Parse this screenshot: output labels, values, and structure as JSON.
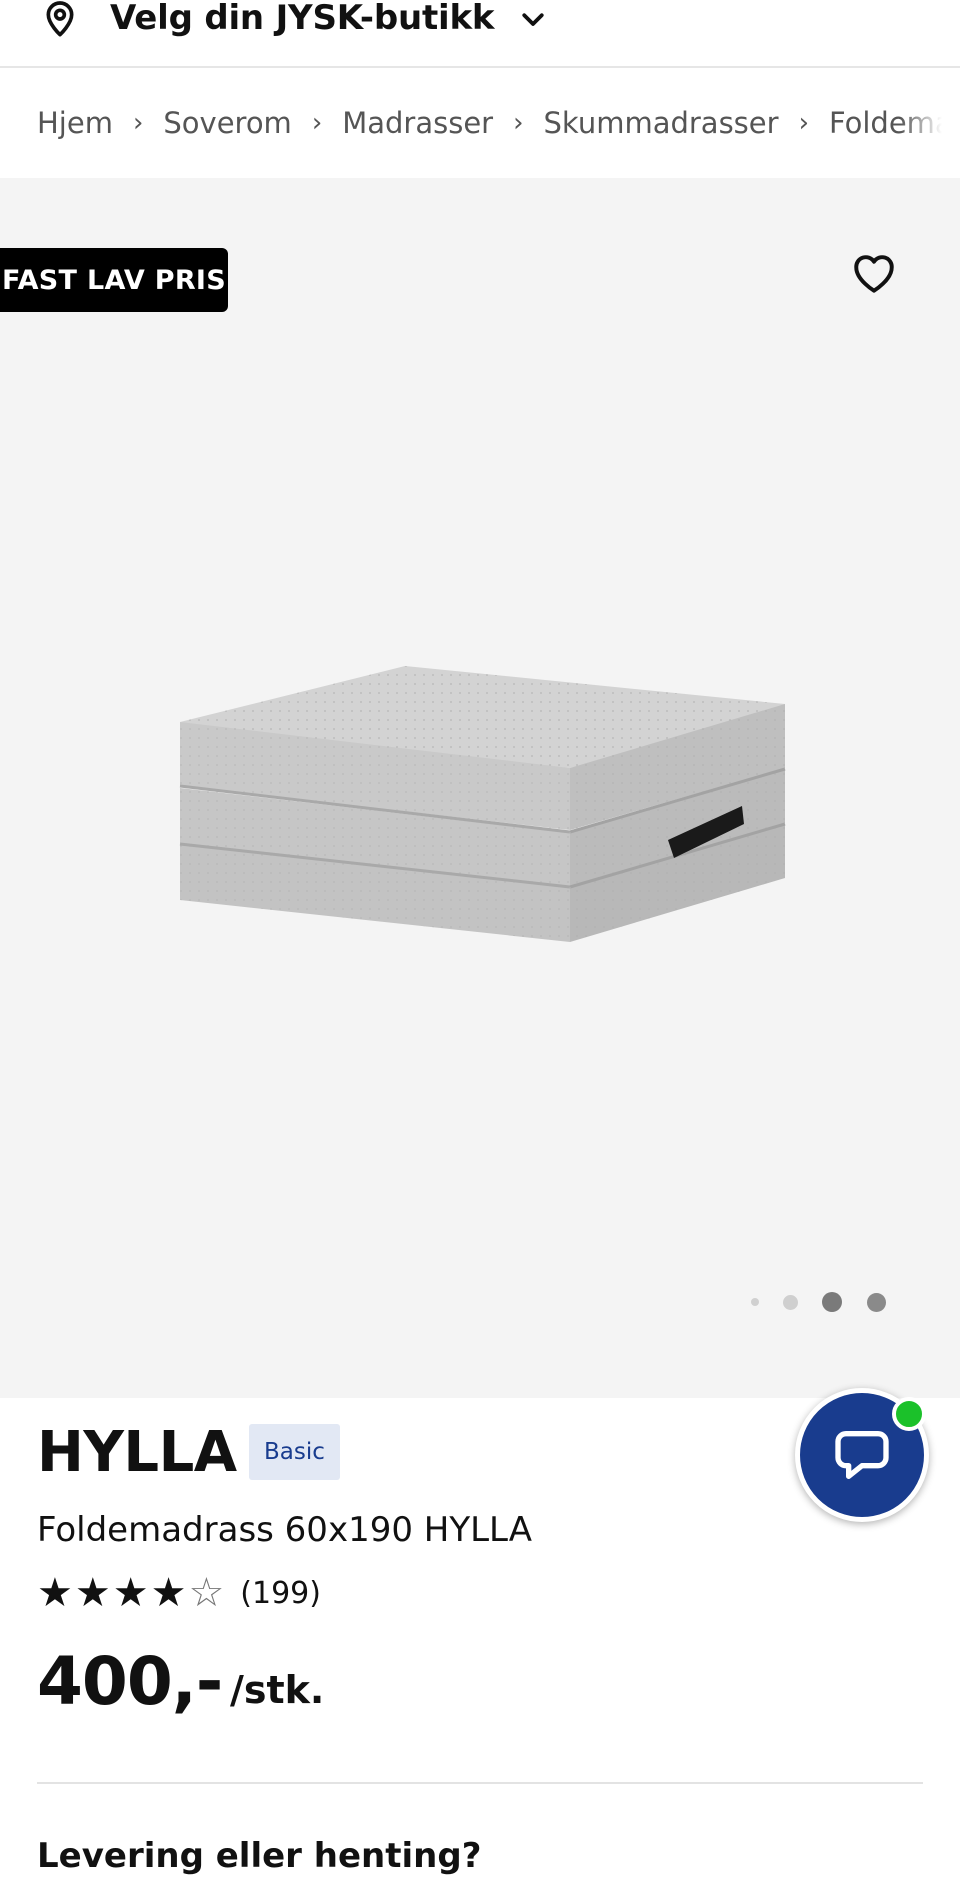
{
  "store_bar": {
    "label": "Velg din JYSK-butikk",
    "pin_icon": "location-pin-icon",
    "chevron_icon": "chevron-down-icon"
  },
  "breadcrumb": {
    "items": [
      "Hjem",
      "Soverom",
      "Madrasser",
      "Skummadrasser",
      "Foldema"
    ]
  },
  "gallery": {
    "badge": "FAST LAV PRIS",
    "favorite_icon": "heart-icon",
    "image_count": 4,
    "active_index": 2
  },
  "product": {
    "brand": "HYLLA",
    "tag": "Basic",
    "name": "Foldemadrass 60x190 HYLLA",
    "rating": 4,
    "rating_max": 5,
    "review_count": "(199)",
    "price": "400,-",
    "unit": "/stk."
  },
  "delivery": {
    "heading": "Levering eller henting?"
  },
  "chat": {
    "icon": "chat-bubble-icon",
    "status_color": "#1bc12a",
    "color": "#193c8e"
  }
}
